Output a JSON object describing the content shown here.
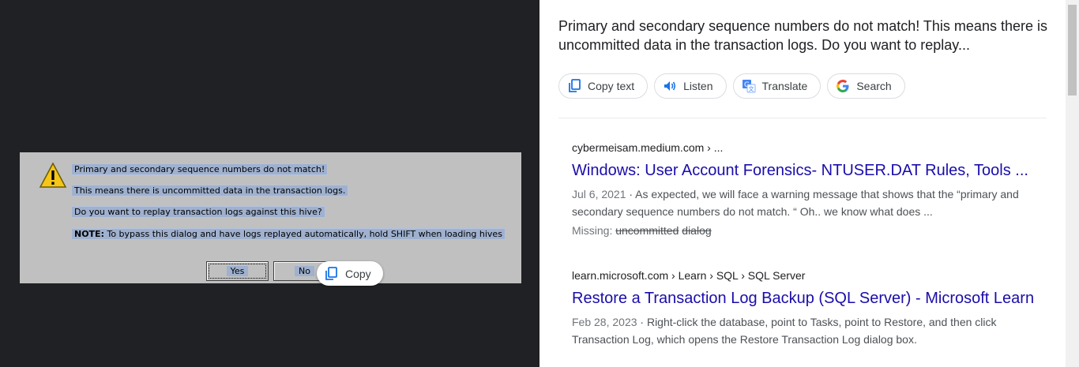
{
  "dialog": {
    "line1": "Primary and secondary sequence numbers do not match!",
    "line2": "This means there is uncommitted data in the transaction logs.",
    "line3": "Do you want to replay transaction logs against this hive?",
    "note_label": "NOTE:",
    "note_text": " To bypass this dialog and have logs replayed automatically, hold SHIFT when loading hives",
    "yes_label": "Yes",
    "no_label": "No"
  },
  "copy_chip": {
    "label": "Copy"
  },
  "query_text": "Primary and secondary sequence numbers do not match! This means there is uncommitted data in the transaction logs. Do you want to replay...",
  "actions": [
    {
      "label": "Copy text",
      "icon": "copy-icon"
    },
    {
      "label": "Listen",
      "icon": "speaker-icon"
    },
    {
      "label": "Translate",
      "icon": "translate-icon"
    },
    {
      "label": "Search",
      "icon": "google-icon"
    }
  ],
  "results": [
    {
      "breadcrumb": "cybermeisam.medium.com › ...",
      "title": "Windows: User Account Forensics- NTUSER.DAT Rules, Tools ...",
      "date": "Jul 6, 2021",
      "snippet": " · As expected, we will face a warning message that shows that the “primary and secondary sequence numbers do not match. “ Oh.. we know what does ...",
      "missing_label": "Missing: ",
      "missing_terms": [
        "uncommitted",
        "dialog"
      ]
    },
    {
      "breadcrumb": "learn.microsoft.com › Learn › SQL › SQL Server",
      "title": "Restore a Transaction Log Backup (SQL Server) - Microsoft Learn",
      "date": "Feb 28, 2023",
      "snippet": " · Right-click the database, point to Tasks, point to Restore, and then click Transaction Log, which opens the Restore Transaction Log dialog box."
    }
  ],
  "colors": {
    "link": "#1a0dab",
    "dark_bg": "#202124",
    "selection": "#9fb1cf"
  }
}
